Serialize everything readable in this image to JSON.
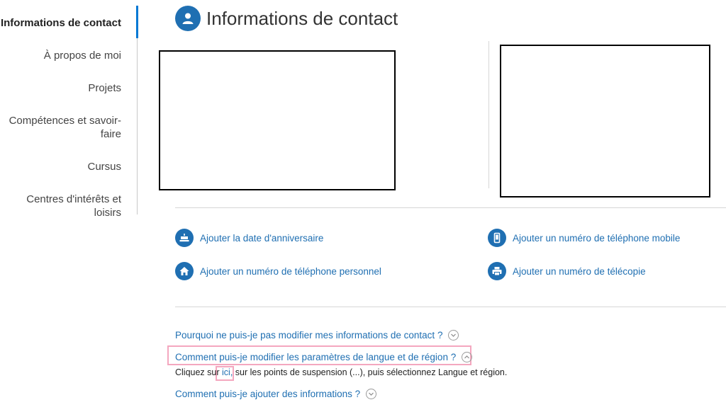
{
  "sidebar": {
    "items": [
      {
        "label": "Informations de contact",
        "active": true
      },
      {
        "label": "À propos de moi"
      },
      {
        "label": "Projets"
      },
      {
        "label": "Compétences et savoir-faire"
      },
      {
        "label": "Cursus"
      },
      {
        "label": "Centres d'intérêts et loisirs"
      }
    ]
  },
  "header": {
    "title": "Informations de contact",
    "icon": "person-icon"
  },
  "actions": {
    "birthday": "Ajouter la date d'anniversaire",
    "mobile": "Ajouter un numéro de téléphone mobile",
    "home_phone": "Ajouter un numéro de téléphone personnel",
    "fax": "Ajouter un numéro de télécopie"
  },
  "faq": {
    "q1": "Pourquoi ne puis-je pas modifier mes informations de contact ?",
    "q2": "Comment puis-je modifier les paramètres de langue et de région ?",
    "q2_answer_before": "Cliquez sur",
    "q2_answer_link": "ici,",
    "q2_answer_after": "sur les points de suspension (...), puis sélectionnez Langue et région.",
    "q3": "Comment puis-je ajouter des informations ?"
  },
  "colors": {
    "accent": "#0078d4",
    "link": "#1f6fb2",
    "highlight": "#f4a7bf"
  }
}
